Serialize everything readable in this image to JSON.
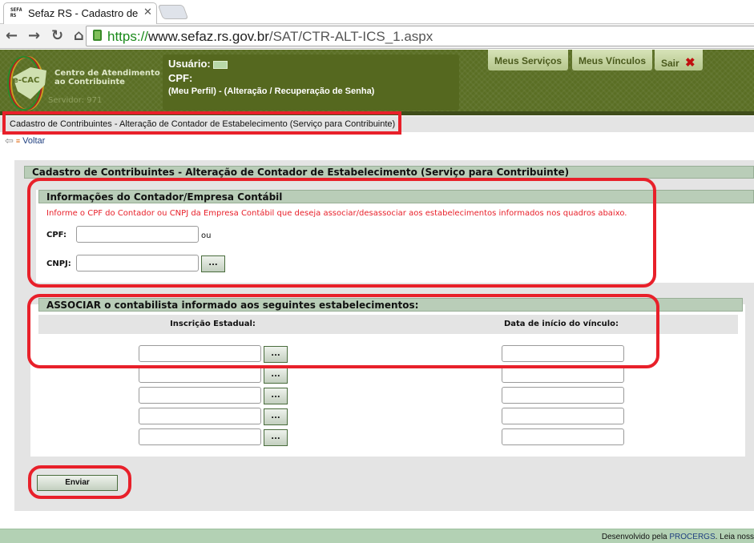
{
  "browser": {
    "tab_title": "Sefaz RS - Cadastro de Co",
    "favicon_text": "SEFA RS",
    "url_scheme": "https://",
    "url_host": "www.sefaz.rs.gov.br",
    "url_path": "/SAT/CTR-ALT-ICS_1.aspx"
  },
  "header": {
    "logo_text": "e-CAC",
    "logo_title_1": "Centro de Atendimento",
    "logo_title_2": "ao Contribuinte",
    "server": "Servidor: 971",
    "user_label": "Usuário:",
    "cpf_label": "CPF:",
    "profile_links": "(Meu Perfil) - (Alteração / Recuperação de Senha)",
    "buttons": {
      "services": "Meus Serviços",
      "links": "Meus Vínculos",
      "logout": "Sair"
    }
  },
  "breadcrumb": "Cadastro de Contribuintes - Alteração de Contador de Estabelecimento (Serviço para Contribuinte)",
  "back_label": "Voltar",
  "form": {
    "title": "Cadastro de Contribuintes - Alteração de Contador de Estabelecimento (Serviço para Contribuinte)",
    "contador": {
      "title": "Informações do Contador/Empresa Contábil",
      "instruction": "Informe o CPF do Contador ou CNPJ da Empresa Contábil que deseja associar/desassociar aos estabelecimentos informados nos quadros abaixo.",
      "cpf_label": "CPF:",
      "cpf_value": "",
      "or_label": "ou",
      "cnpj_label": "CNPJ:",
      "cnpj_value": "",
      "lookup_label": "..."
    },
    "associar": {
      "title": "ASSOCIAR o contabilista informado aos seguintes estabelecimentos:",
      "col_ie": "Inscrição Estadual:",
      "col_date": "Data de início do vínculo:",
      "lookup_label": "...",
      "rows": [
        {
          "ie": "",
          "date": ""
        },
        {
          "ie": "",
          "date": ""
        },
        {
          "ie": "",
          "date": ""
        },
        {
          "ie": "",
          "date": ""
        },
        {
          "ie": "",
          "date": ""
        }
      ]
    },
    "submit_label": "Enviar"
  },
  "footer": {
    "text": "Desenvolvido pela ",
    "link": "PROCERGS",
    "text2": ". Leia noss"
  },
  "colors": {
    "header_green": "#5a6e24",
    "section_green": "#b9cdb8",
    "annotation_red": "#e8202a",
    "instruction_red": "#e8202a"
  }
}
